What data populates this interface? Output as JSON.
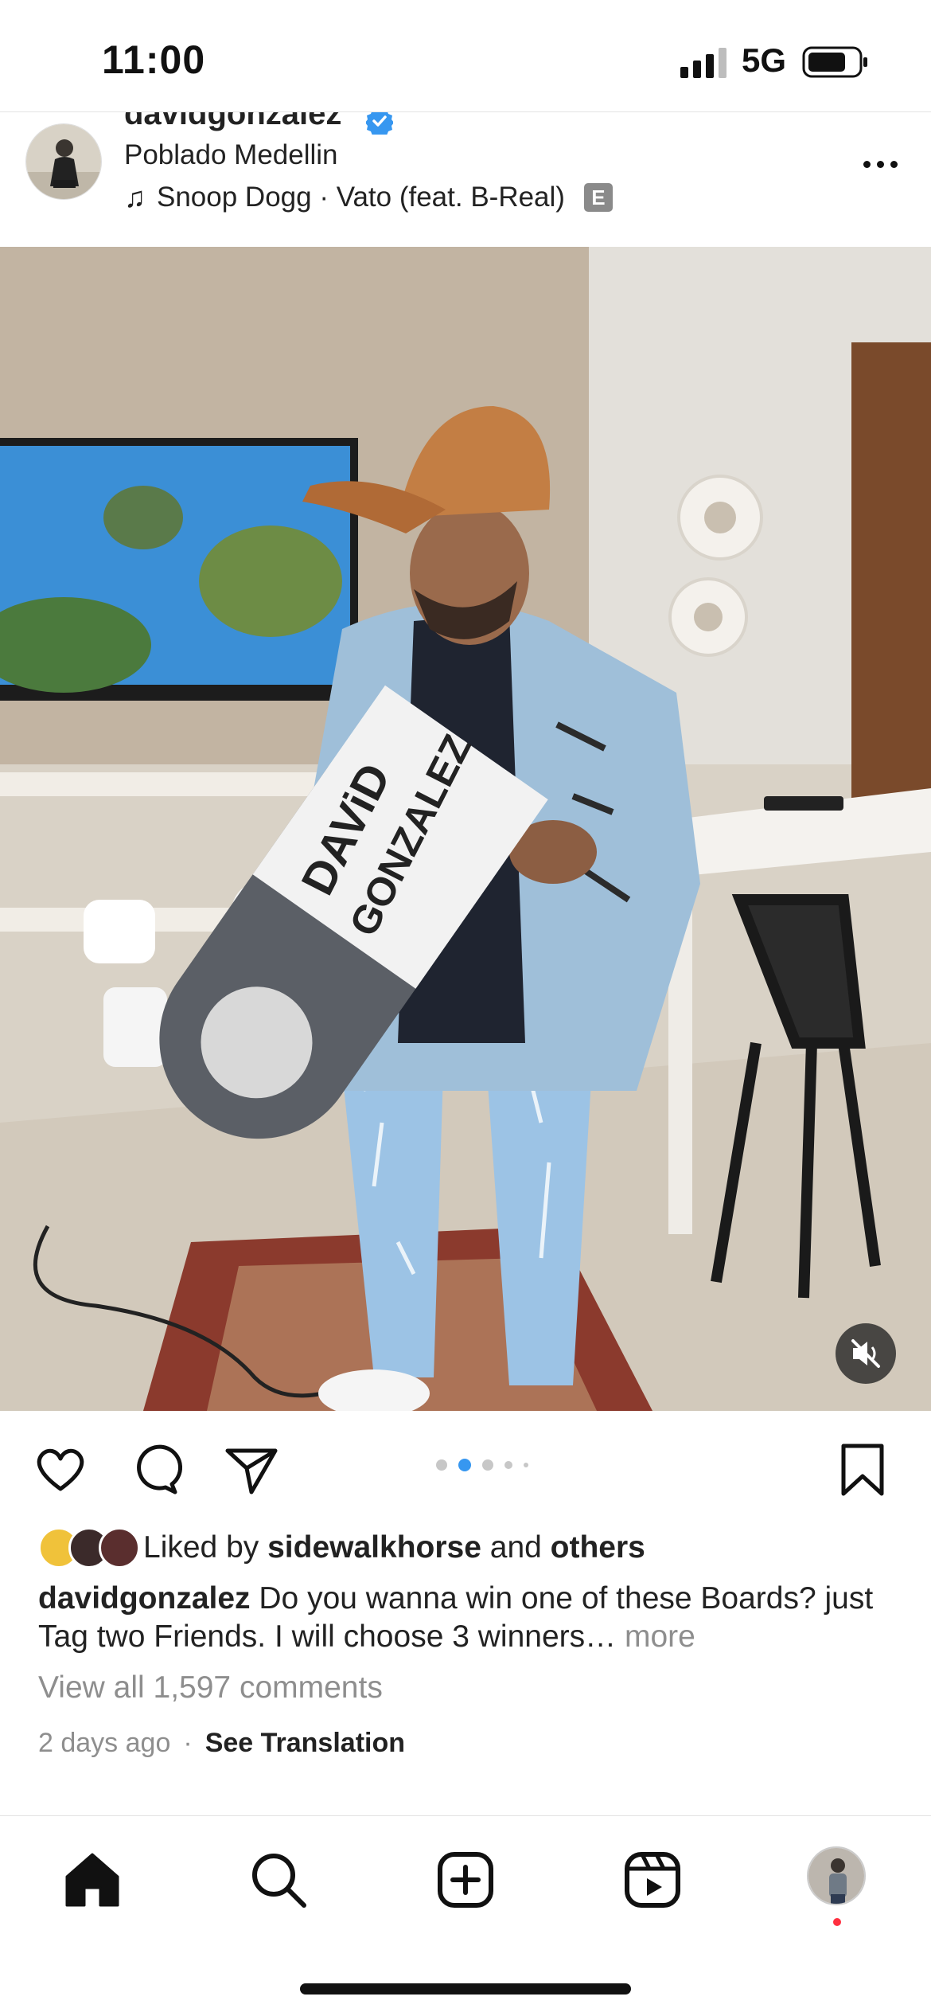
{
  "status_bar": {
    "time": "11:00",
    "network": "5G",
    "icons": [
      "cellular-signal-icon",
      "battery-icon"
    ]
  },
  "post": {
    "username": "davidgonzalez",
    "verified": true,
    "location": "Poblado Medellin",
    "music": "Snoop Dogg · Vato (feat. B-Real)",
    "explicit_badge": "E",
    "carousel": {
      "count": 5,
      "active_index": 1
    }
  },
  "actions": {
    "icons": [
      "heart-icon",
      "comment-icon",
      "share-icon",
      "bookmark-icon"
    ]
  },
  "likes": {
    "prefix": "Liked by",
    "user": "sidewalkhorse",
    "joiner": "and",
    "others": "others"
  },
  "caption": {
    "username": "davidgonzalez",
    "text": "Do you wanna win one of these Boards? just Tag two Friends. I will choose 3  winners…",
    "more": "more"
  },
  "comments": {
    "view_all": "View all 1,597 comments"
  },
  "meta": {
    "time_ago": "2 days ago",
    "separator": "·",
    "translate": "See Translation"
  },
  "tab_bar": {
    "icons": [
      "home-icon",
      "search-icon",
      "create-post-icon",
      "reels-icon",
      "profile-avatar"
    ],
    "has_notification": true
  },
  "colors": {
    "accent": "#3797f0",
    "notification": "#ff3040",
    "muted_text": "#8e8e8e"
  }
}
